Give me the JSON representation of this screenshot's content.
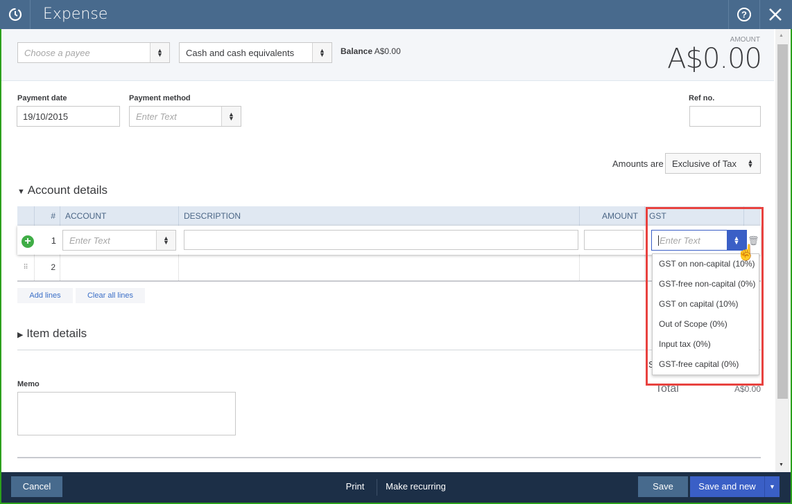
{
  "header": {
    "title": "Expense",
    "help_icon": "help-circle-icon",
    "close_icon": "close-icon",
    "logo_icon": "recurring-clock-icon"
  },
  "top": {
    "payee_placeholder": "Choose a payee",
    "account_value": "Cash and cash equivalents",
    "balance_label": "Balance",
    "balance_value": "A$0.00",
    "amount_label": "AMOUNT",
    "amount_value": "A$0.00"
  },
  "form": {
    "payment_date_label": "Payment date",
    "payment_date_value": "19/10/2015",
    "payment_method_label": "Payment method",
    "payment_method_placeholder": "Enter Text",
    "ref_label": "Ref no.",
    "ref_value": "",
    "amounts_are_label": "Amounts are",
    "amounts_are_value": "Exclusive of Tax"
  },
  "account_details": {
    "title": "Account details",
    "columns": [
      "#",
      "ACCOUNT",
      "DESCRIPTION",
      "AMOUNT",
      "GST"
    ],
    "rows": [
      {
        "num": "1",
        "account_placeholder": "Enter Text",
        "gst_placeholder": "Enter Text"
      },
      {
        "num": "2"
      }
    ],
    "add_lines": "Add lines",
    "clear_lines": "Clear all lines"
  },
  "gst_options": [
    "GST on non-capital (10%)",
    "GST-free non-capital (0%)",
    "GST on capital (10%)",
    "Out of Scope (0%)",
    "Input tax (0%)",
    "GST-free capital (0%)"
  ],
  "item_details": {
    "title": "Item details"
  },
  "memo": {
    "label": "Memo",
    "value": ""
  },
  "totals": {
    "subtotal_partial": "S",
    "total_label": "Total",
    "total_value": "A$0.00"
  },
  "footer": {
    "cancel": "Cancel",
    "print": "Print",
    "make_recurring": "Make recurring",
    "save": "Save",
    "save_and_new": "Save and new"
  },
  "colors": {
    "header": "#486a8d",
    "footer": "#1c2f47",
    "primary": "#3a5fc6",
    "add_icon": "#3fad46",
    "highlight": "#e8423f"
  }
}
